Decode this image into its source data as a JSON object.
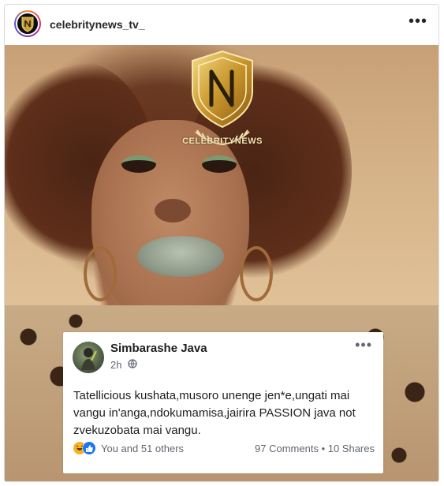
{
  "post": {
    "username": "celebritynews_tv_",
    "more_icon": "more-horizontal-icon",
    "watermark_text": "CELEBRITYNEWS"
  },
  "embedded_post": {
    "author": "Simbarashe Java",
    "time": "2h",
    "privacy_icon": "globe-icon",
    "text": "Tatellicious kushata,musoro unenge jen*e,ungati mai vangu in'anga,ndokumamisa,jairira PASSION java not zvekuzobata mai vangu.",
    "reaction_icons": [
      "haha-reaction-icon",
      "like-reaction-icon"
    ],
    "likes_text": "You and 51 others",
    "counts_text": "97 Comments • 10 Shares"
  },
  "colors": {
    "text_primary": "#262626",
    "fb_text": "#1c1e21",
    "fb_meta": "#606770",
    "like_blue": "#1877f2",
    "haha_yellow": "#f7b125"
  }
}
